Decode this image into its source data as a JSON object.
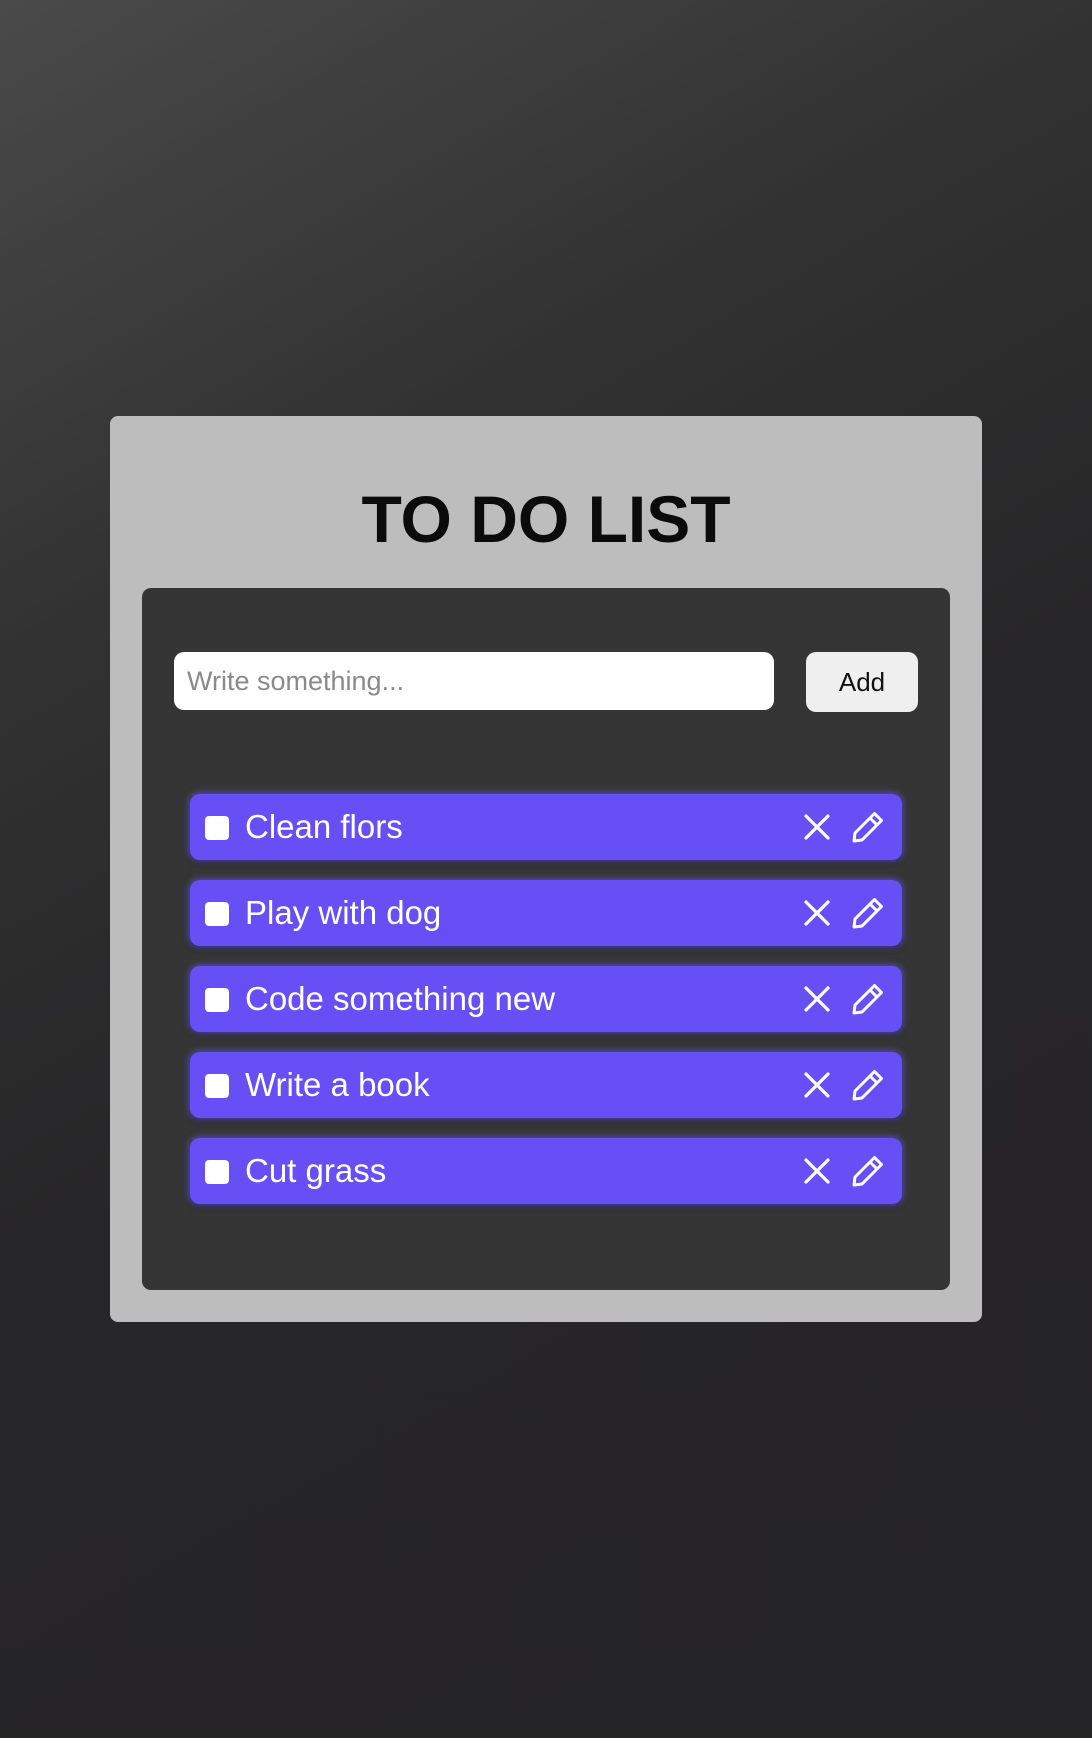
{
  "app": {
    "title": "TO DO LIST"
  },
  "form": {
    "input_placeholder": "Write something...",
    "input_value": "",
    "add_label": "Add"
  },
  "todos": [
    {
      "text": "Clean flors",
      "checked": false
    },
    {
      "text": "Play with dog",
      "checked": false
    },
    {
      "text": "Code something new",
      "checked": false
    },
    {
      "text": "Write a book",
      "checked": false
    },
    {
      "text": "Cut grass",
      "checked": false
    }
  ],
  "icons": {
    "delete": "close-icon",
    "edit": "pencil-icon"
  },
  "colors": {
    "background_top": "#4a4a4a",
    "background_bottom": "#252426",
    "card": "#bdbdbd",
    "panel": "#353535",
    "item": "#6650f5",
    "item_text": "#ffffff",
    "title": "#0b0b0b",
    "add_button": "#efefef"
  }
}
